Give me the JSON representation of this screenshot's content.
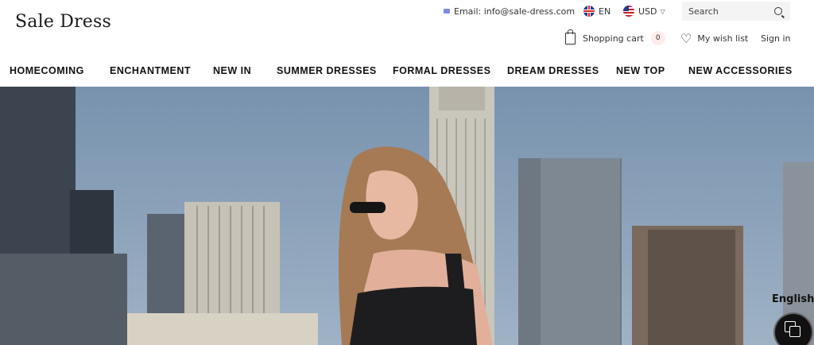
{
  "brand": {
    "logo_text": "Sale Dress"
  },
  "topbar": {
    "email_label": "Email: info@sale-dress.com",
    "language_label": "EN",
    "currency_label": "USD",
    "search_placeholder": "Search"
  },
  "account": {
    "cart_label": "Shopping cart",
    "cart_count": "0",
    "wishlist_label": "My wish list",
    "signin_label": "Sign in"
  },
  "nav": {
    "items": [
      {
        "label": "HOMECOMING"
      },
      {
        "label": "ENCHANTMENT"
      },
      {
        "label": "NEW IN"
      },
      {
        "label": "SUMMER DRESSES"
      },
      {
        "label": "FORMAL DRESSES"
      },
      {
        "label": "DREAM DRESSES"
      },
      {
        "label": "NEW TOP"
      },
      {
        "label": "NEW ACCESSORIES"
      }
    ]
  },
  "widget": {
    "language_name": "English"
  },
  "colors": {
    "badge_bg": "#ffecec",
    "text": "#111111",
    "hero_sky": "#8fa6ba"
  }
}
